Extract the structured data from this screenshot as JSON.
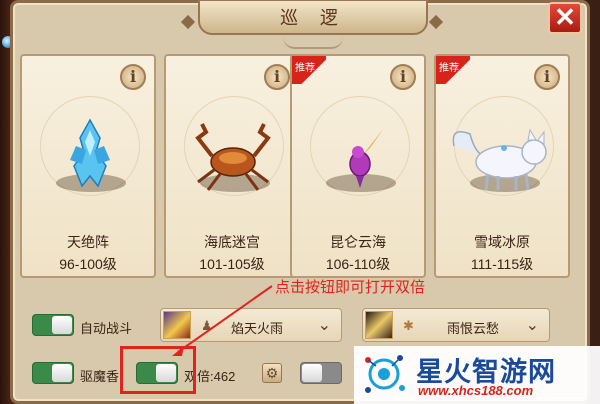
{
  "window": {
    "title": "巡 逻",
    "close_label": "✕"
  },
  "cards": [
    {
      "name": "天绝阵",
      "level": "96-100级",
      "badge": "",
      "creature": "ice-crystal"
    },
    {
      "name": "海底迷宫",
      "level": "101-105级",
      "badge": "",
      "creature": "crab"
    },
    {
      "name": "昆仑云海",
      "level": "106-110级",
      "badge": "推荐",
      "creature": "bird"
    },
    {
      "name": "雪域冰原",
      "level": "111-115级",
      "badge": "推荐",
      "creature": "snow-fox"
    }
  ],
  "info_label": "i",
  "auto_battle": {
    "label": "自动战斗",
    "on": true
  },
  "skill_1": {
    "name": "焰天火雨",
    "icon": "fire-skill-icon"
  },
  "skill_2": {
    "name": "雨恨云愁",
    "icon": "claw-skill-icon"
  },
  "repel": {
    "label": "驱魔香",
    "on": true
  },
  "double": {
    "label": "双倍:462",
    "on": true
  },
  "third_toggle": {
    "on": false
  },
  "hint_text": "点击按钮即可打开双倍",
  "watermark": {
    "main": "星火智游网",
    "sub": "www.xhcs188.com"
  },
  "colors": {
    "accent": "#e0241c",
    "toggle_on": "#3a8a4a",
    "panel": "#d8c9ac"
  }
}
